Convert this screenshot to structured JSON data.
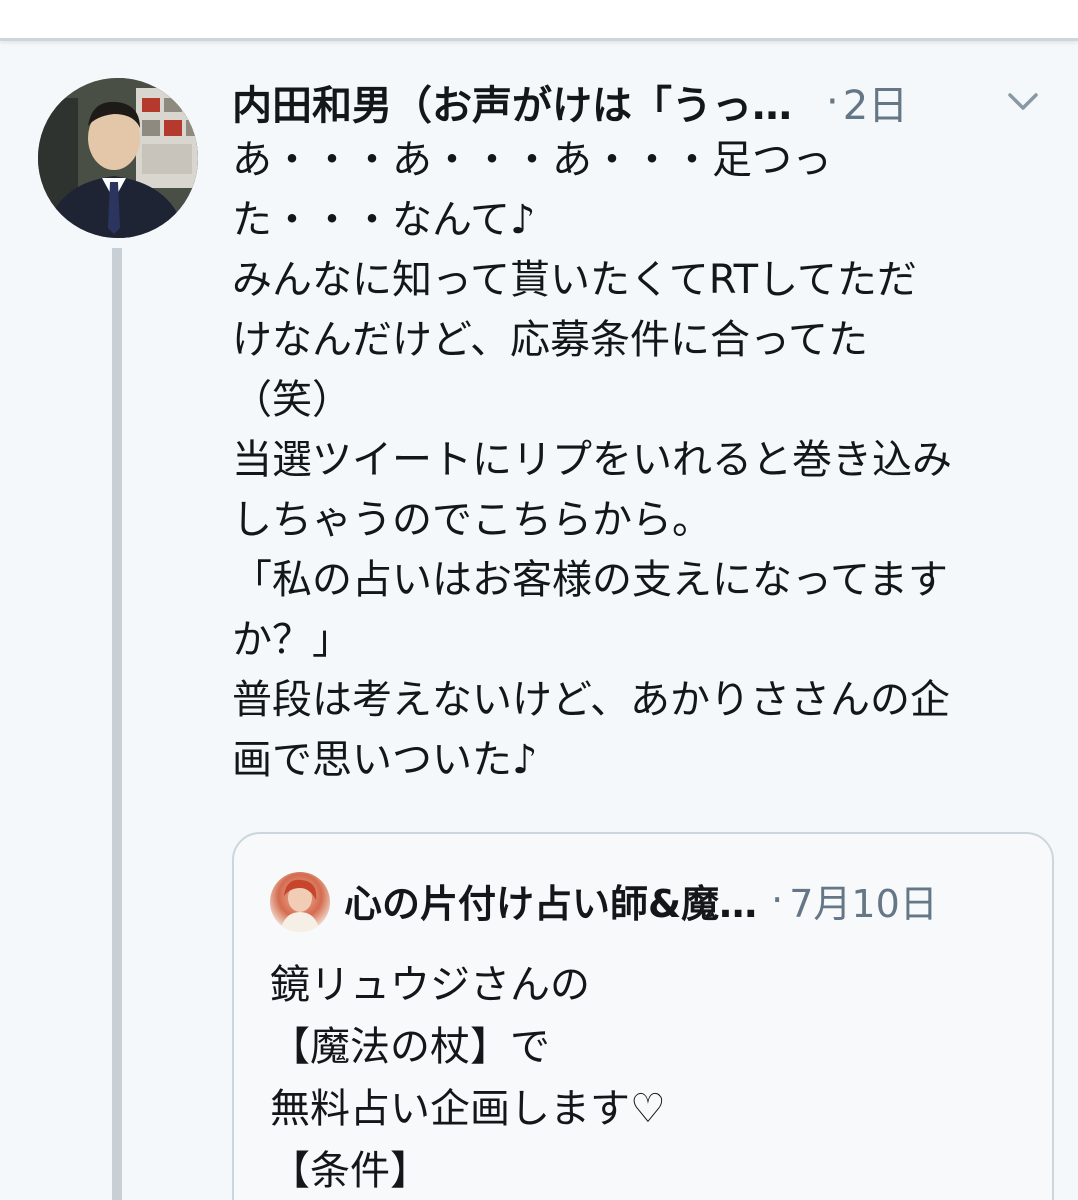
{
  "tweet": {
    "author_name": "内田和男（お声がけは「うっ…",
    "separator": "·",
    "time": "2日",
    "menu_icon": "chevron-down-icon",
    "avatar_icon": "user-avatar",
    "lines": [
      "あ・・・あ・・・あ・・・足つっ",
      "た・・・なんて♪",
      "みんなに知って貰いたくてRTしてただ",
      "けなんだけど、応募条件に合ってた",
      "（笑）",
      "当選ツイートにリプをいれると巻き込み",
      "しちゃうのでこちらから。",
      "「私の占いはお客様の支えになってます",
      "か？」",
      "普段は考えないけど、あかりささんの企",
      "画で思いついた♪"
    ]
  },
  "quoted_tweet": {
    "author_name": "心の片付け占い師&魔…",
    "separator": "·",
    "time": "7月10日",
    "avatar_icon": "quoted-user-avatar",
    "lines": [
      "鏡リュウジさんの",
      "【魔法の杖】で",
      "無料占い企画します♡",
      "【条件】"
    ]
  },
  "colors": {
    "text_primary": "#14171a",
    "text_secondary": "#657786",
    "background": "#f5f8fa",
    "border": "#ccd6dd",
    "thread_line": "#c9d0d5"
  }
}
